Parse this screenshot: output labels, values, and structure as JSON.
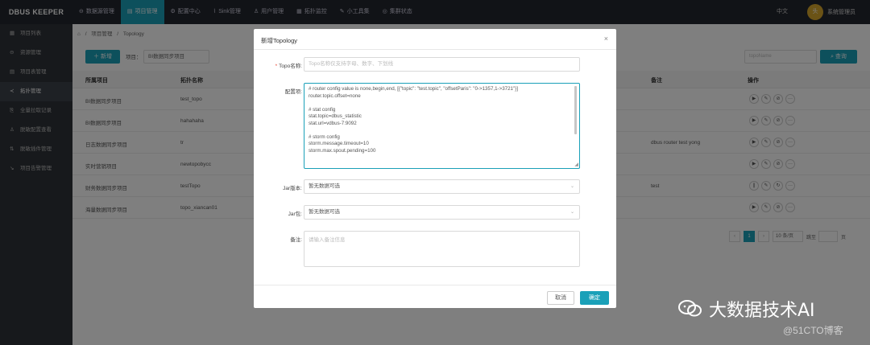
{
  "app": {
    "logo": "DBUS KEEPER",
    "lang": "中文",
    "avatar_text": "头",
    "user": "系统管理员"
  },
  "nav": [
    {
      "icon": "⊖",
      "label": "数据源管理"
    },
    {
      "icon": "▤",
      "label": "项目管理"
    },
    {
      "icon": "⚙",
      "label": "配置中心"
    },
    {
      "icon": "⌇",
      "label": "Sink管理"
    },
    {
      "icon": "♙",
      "label": "用户管理"
    },
    {
      "icon": "▦",
      "label": "拓扑监控"
    },
    {
      "icon": "✎",
      "label": "小工具集"
    },
    {
      "icon": "◎",
      "label": "集群状态"
    }
  ],
  "sidebar": [
    {
      "icon": "▦",
      "label": "项目列表"
    },
    {
      "icon": "⊖",
      "label": "资源管理"
    },
    {
      "icon": "▤",
      "label": "项目表管理"
    },
    {
      "icon": "≺",
      "label": "拓扑管理"
    },
    {
      "icon": "⎘",
      "label": "全量拉取记录"
    },
    {
      "icon": "♙",
      "label": "脱敏配置查看"
    },
    {
      "icon": "⇅",
      "label": "脱敏插件管理"
    },
    {
      "icon": "↘",
      "label": "项目告警管理"
    }
  ],
  "breadcrumb": {
    "home": "⌂",
    "sep": "/",
    "level1": "项目管理",
    "level2": "Topology"
  },
  "toolbar": {
    "add": "＋ 新增",
    "proj_label": "项目：",
    "proj_value": "BI数据同步项目",
    "filter_placeholder": "topoName",
    "search": "⌕ 查询"
  },
  "table": {
    "headers": {
      "project": "所属项目",
      "topo": "拓扑名称",
      "remark": "备注",
      "ops": "操作"
    },
    "rows": [
      {
        "project": "BI数据同步项目",
        "topo": "test_topo",
        "remark": ""
      },
      {
        "project": "BI数据同步项目",
        "topo": "hahahaha",
        "remark": ""
      },
      {
        "project": "日志数据同步项目",
        "topo": "tr",
        "remark": "dbus router test yong"
      },
      {
        "project": "实时营销项目",
        "topo": "newtopobycc",
        "remark": ""
      },
      {
        "project": "财务数据同步项目",
        "topo": "testTopo",
        "remark": "test"
      },
      {
        "project": "海量数据同步项目",
        "topo": "topo_xiancan01",
        "remark": ""
      }
    ]
  },
  "pager": {
    "prev": "‹",
    "page": "1",
    "next": "›",
    "size": "10 条/页",
    "jump": "跳至",
    "suffix": "页"
  },
  "modal": {
    "title": "新增Topology",
    "close": "×",
    "topo_label": "Topo名称:",
    "topo_placeholder": "Topo名称仅支持字母、数字、下划线",
    "config_label": "配置项:",
    "config_lines": [
      "# router config value is none,begin,end, [{\"topic\": \"test.topic\", \"offsetParis\": \"0->1357,1->3721\"}]",
      "router.topic.offset=none",
      "",
      "# stat config",
      "stat.topic=dbus_statistic",
      "stat.url=vdbus-7:9092",
      "",
      "# storm config",
      "storm.message.timeout=10",
      "storm.max.spout.pending=100"
    ],
    "jar_version_label": "Jar版本:",
    "jar_version_value": "暂无数据可选",
    "jar_label": "Jar包:",
    "jar_value": "暂无数据可选",
    "remark_label": "备注:",
    "remark_placeholder": "请输入备注信息",
    "cancel": "取消",
    "ok": "确定"
  },
  "watermark": {
    "main": "大数据技术AI",
    "sub": "@51CTO博客"
  }
}
